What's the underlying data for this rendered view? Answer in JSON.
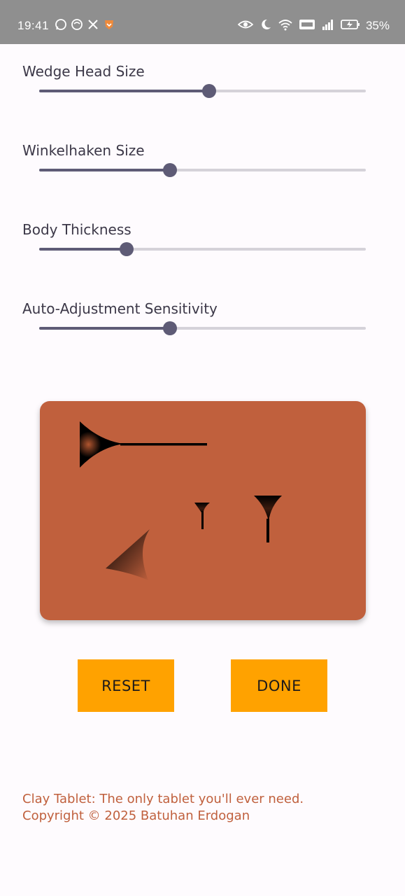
{
  "status_bar": {
    "time": "19:41",
    "battery": "35%",
    "left_icons": [
      "whatsapp-icon",
      "instagram-icon",
      "x-icon",
      "brave-icon"
    ],
    "right_icons": [
      "eye-icon",
      "moon-icon",
      "wifi-icon",
      "volte-icon",
      "signal-icon",
      "battery-charging-icon"
    ]
  },
  "sliders": [
    {
      "label": "Wedge Head Size",
      "value": 0.52
    },
    {
      "label": "Winkelhaken Size",
      "value": 0.4
    },
    {
      "label": "Body Thickness",
      "value": 0.267
    },
    {
      "label": "Auto-Adjustment Sensitivity",
      "value": 0.4
    }
  ],
  "tablet": {
    "color": "#c0603d",
    "marks": [
      "horizontal-wedge",
      "winkelhaken",
      "small-vertical-wedge",
      "vertical-wedge"
    ]
  },
  "buttons": {
    "reset": "RESET",
    "done": "DONE",
    "color": "#ffa200"
  },
  "footer": {
    "line1": "Clay Tablet: The only tablet you'll ever need.",
    "line2": "Copyright © 2025 Batuhan Erdogan"
  },
  "colors": {
    "accent": "#5e5b76",
    "track": "#d5d2d9",
    "clay": "#c0603d",
    "button": "#ffa200"
  }
}
